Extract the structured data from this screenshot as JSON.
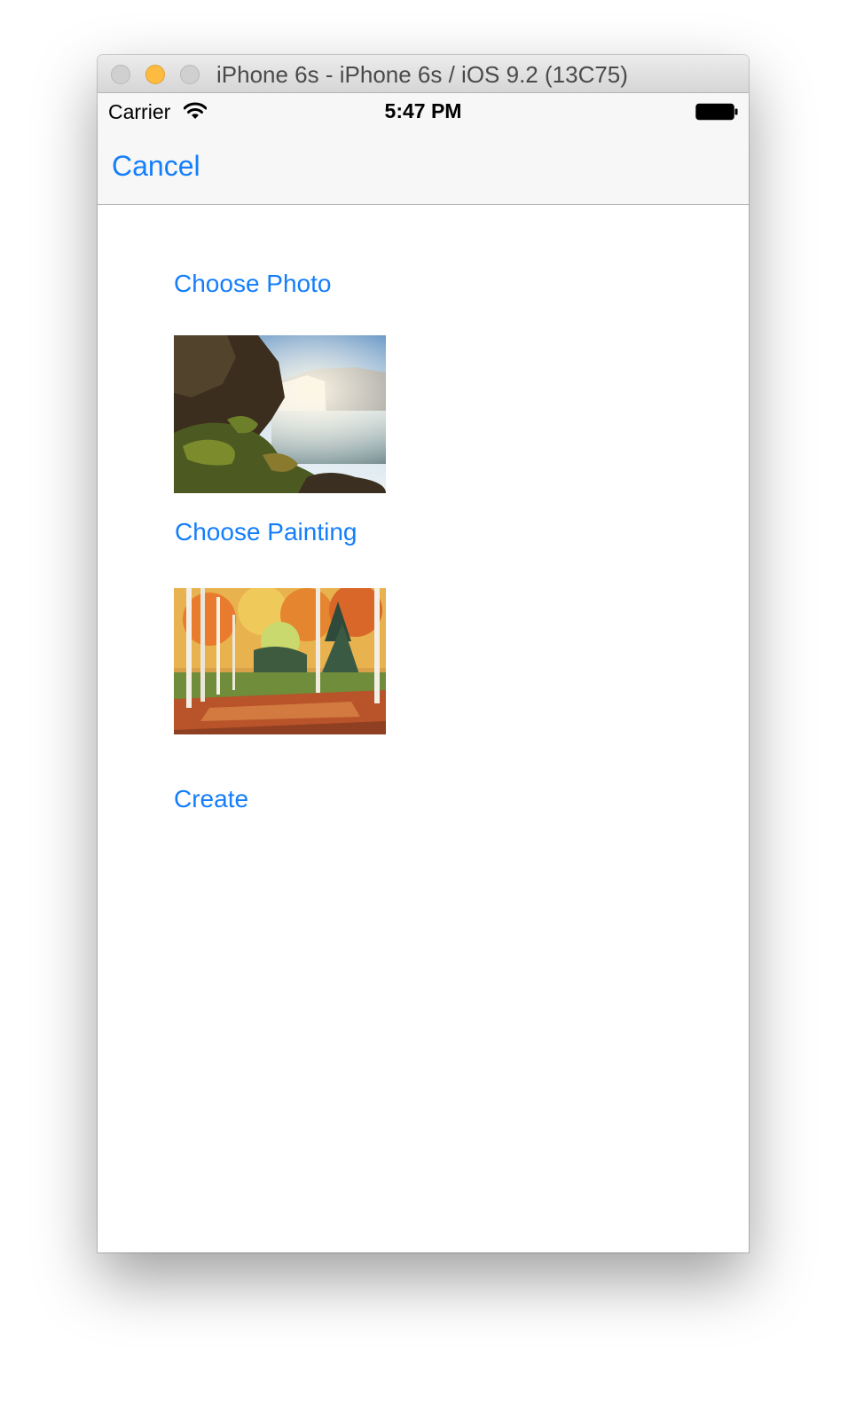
{
  "window": {
    "title": "iPhone 6s - iPhone 6s / iOS 9.2 (13C75)"
  },
  "status_bar": {
    "carrier": "Carrier",
    "time": "5:47 PM",
    "wifi_icon": "wifi-icon",
    "battery_icon": "battery-icon"
  },
  "nav": {
    "cancel_label": "Cancel"
  },
  "content": {
    "choose_photo_label": "Choose Photo",
    "photo_image": "waterfall-photo",
    "choose_painting_label": "Choose Painting",
    "painting_image": "autumn-forest-painting",
    "create_label": "Create"
  },
  "colors": {
    "tint": "#147efb",
    "nav_background": "#f7f7f7",
    "traffic_minimize": "#fdbc40"
  }
}
